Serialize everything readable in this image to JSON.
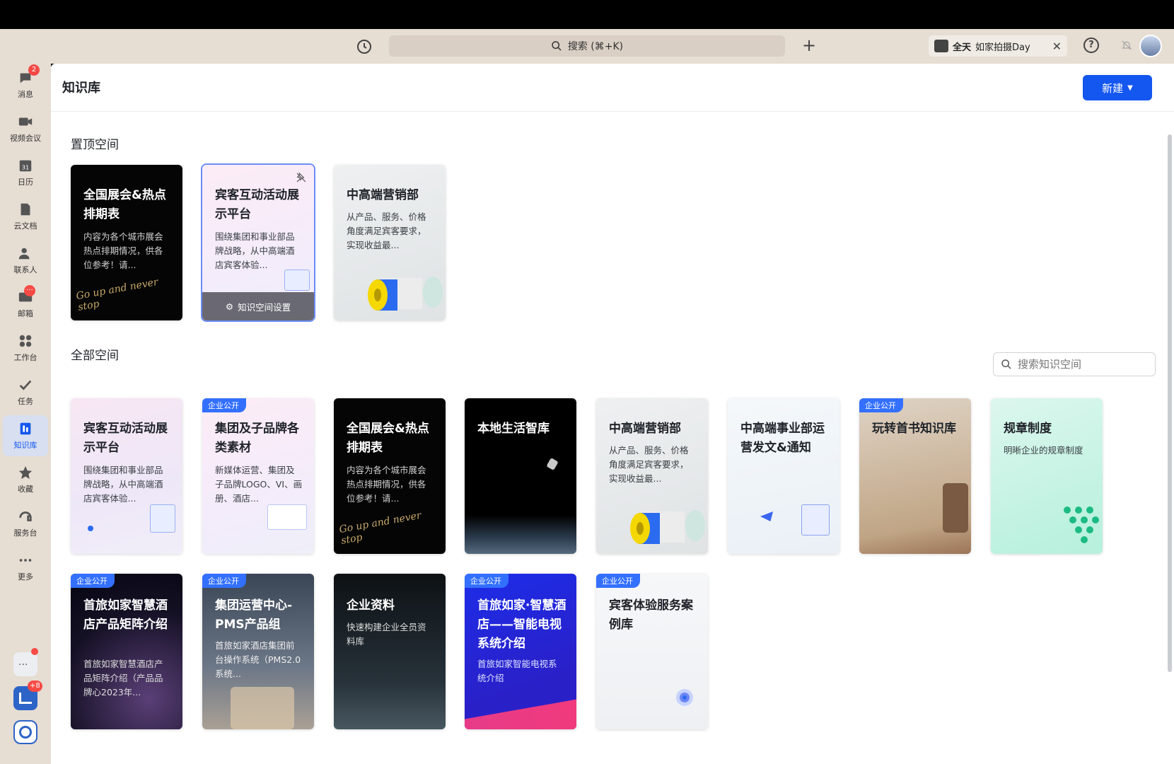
{
  "titlebar": {
    "search_placeholder": "搜索 (⌘+K)",
    "event_label": "全天",
    "event_title": "如家拍摄Day"
  },
  "sidebar": {
    "items": [
      {
        "label": "消息",
        "icon": "chat-bubble-icon",
        "badge": "2"
      },
      {
        "label": "视频会议",
        "icon": "video-camera-icon"
      },
      {
        "label": "日历",
        "icon": "calendar-icon",
        "day": "31"
      },
      {
        "label": "云文档",
        "icon": "document-icon"
      },
      {
        "label": "联系人",
        "icon": "contacts-icon"
      },
      {
        "label": "邮箱",
        "icon": "mail-icon",
        "badge": "···"
      },
      {
        "label": "工作台",
        "icon": "workbench-icon"
      },
      {
        "label": "任务",
        "icon": "task-check-icon"
      },
      {
        "label": "知识库",
        "icon": "knowledge-base-icon",
        "active": true
      },
      {
        "label": "收藏",
        "icon": "star-icon"
      },
      {
        "label": "服务台",
        "icon": "headset-icon"
      },
      {
        "label": "更多",
        "icon": "more-dots-icon"
      }
    ],
    "bottom_badge": "+8"
  },
  "page": {
    "title": "知识库",
    "new_button": "新建"
  },
  "pinned": {
    "title": "置顶空间",
    "cards": [
      {
        "title": "全国展会&热点排期表",
        "desc": "内容为各个城市展会热点排期情况，供各位参考！请...",
        "script": "Go up and never stop"
      },
      {
        "title": "宾客互动活动展示平台",
        "desc": "围绕集团和事业部品牌战略，从中高端酒店宾客体验...",
        "overlay": "知识空间设置"
      },
      {
        "title": "中高端营销部",
        "desc": "从产品、服务、价格角度满足宾客要求，实现收益最..."
      }
    ]
  },
  "all": {
    "title": "全部空间",
    "search_placeholder": "搜索知识空间",
    "row1": [
      {
        "title": "宾客互动活动展示平台",
        "desc": "围绕集团和事业部品牌战略，从中高端酒店宾客体验..."
      },
      {
        "title": "集团及子品牌各类素材",
        "desc": "新媒体运营、集团及子品牌LOGO、VI、画册、酒店...",
        "tag": "企业公开"
      },
      {
        "title": "全国展会&热点排期表",
        "desc": "内容为各个城市展会热点排期情况，供各位参考！请...",
        "script": "Go up and never stop"
      },
      {
        "title": "本地生活智库",
        "desc": ""
      },
      {
        "title": "中高端营销部",
        "desc": "从产品、服务、价格角度满足宾客要求，实现收益最..."
      },
      {
        "title": "中高端事业部运营发文&通知",
        "desc": ""
      },
      {
        "title": "玩转首书知识库",
        "desc": "",
        "tag": "企业公开"
      },
      {
        "title": "规章制度",
        "desc": "明晰企业的规章制度"
      }
    ],
    "row2": [
      {
        "title": "首旅如家智慧酒店产品矩阵介绍",
        "desc": "首旅如家智慧酒店产品矩阵介绍（产品品牌心2023年...",
        "tag": "企业公开"
      },
      {
        "title": "集团运营中心-PMS产品组",
        "desc": "首旅如家酒店集团前台操作系统（PMS2.0系统...",
        "tag": "企业公开"
      },
      {
        "title": "企业资料",
        "desc": "快速构建企业全员资料库"
      },
      {
        "title": "首旅如家·智慧酒店——智能电视系统介绍",
        "desc": "首旅如家智能电视系统介绍",
        "tag": "企业公开"
      },
      {
        "title": "宾客体验服务案例库",
        "desc": "",
        "tag": "企业公开"
      }
    ]
  }
}
